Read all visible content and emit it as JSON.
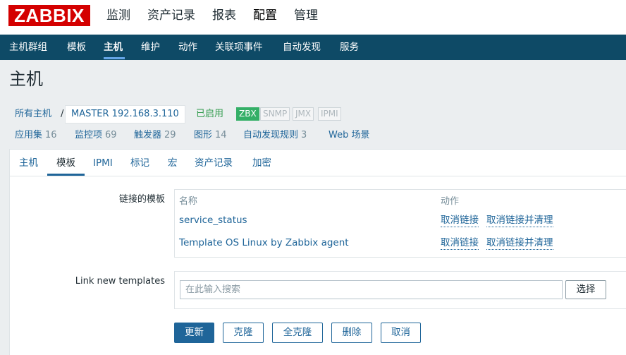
{
  "logo": "ZABBIX",
  "main_menu": [
    "监测",
    "资产记录",
    "报表",
    "配置",
    "管理"
  ],
  "sub_nav": [
    "主机群组",
    "模板",
    "主机",
    "维护",
    "动作",
    "关联项事件",
    "自动发现",
    "服务"
  ],
  "page_title": "主机",
  "breadcrumb": {
    "all_hosts": "所有主机",
    "separator": "/",
    "host": "MASTER 192.168.3.110"
  },
  "status": "已启用",
  "availability": [
    "ZBX",
    "SNMP",
    "JMX",
    "IPMI"
  ],
  "counts": [
    {
      "label": "应用集",
      "count": "16"
    },
    {
      "label": "监控项",
      "count": "69"
    },
    {
      "label": "触发器",
      "count": "29"
    },
    {
      "label": "图形",
      "count": "14"
    },
    {
      "label": "自动发现规则",
      "count": "3"
    },
    {
      "label": "Web 场景",
      "count": ""
    }
  ],
  "tabs": [
    "主机",
    "模板",
    "IPMI",
    "标记",
    "宏",
    "资产记录",
    "加密"
  ],
  "linked_templates": {
    "label": "链接的模板",
    "col_name": "名称",
    "col_action": "动作",
    "rows": [
      {
        "name": "service_status",
        "unlink": "取消链接",
        "unlink_clear": "取消链接并清理"
      },
      {
        "name": "Template OS Linux by Zabbix agent",
        "unlink": "取消链接",
        "unlink_clear": "取消链接并清理"
      }
    ]
  },
  "link_new": {
    "label": "Link new templates",
    "placeholder": "在此输入搜索",
    "select_label": "选择"
  },
  "buttons": {
    "update": "更新",
    "clone": "克隆",
    "full_clone": "全克隆",
    "delete": "删除",
    "cancel": "取消"
  },
  "colors": {
    "logo_red": "#d40000",
    "nav_blue": "#0e4a66",
    "link_blue": "#1f6599",
    "enabled_green": "#2f9b4b",
    "zbx_green": "#34af67"
  }
}
